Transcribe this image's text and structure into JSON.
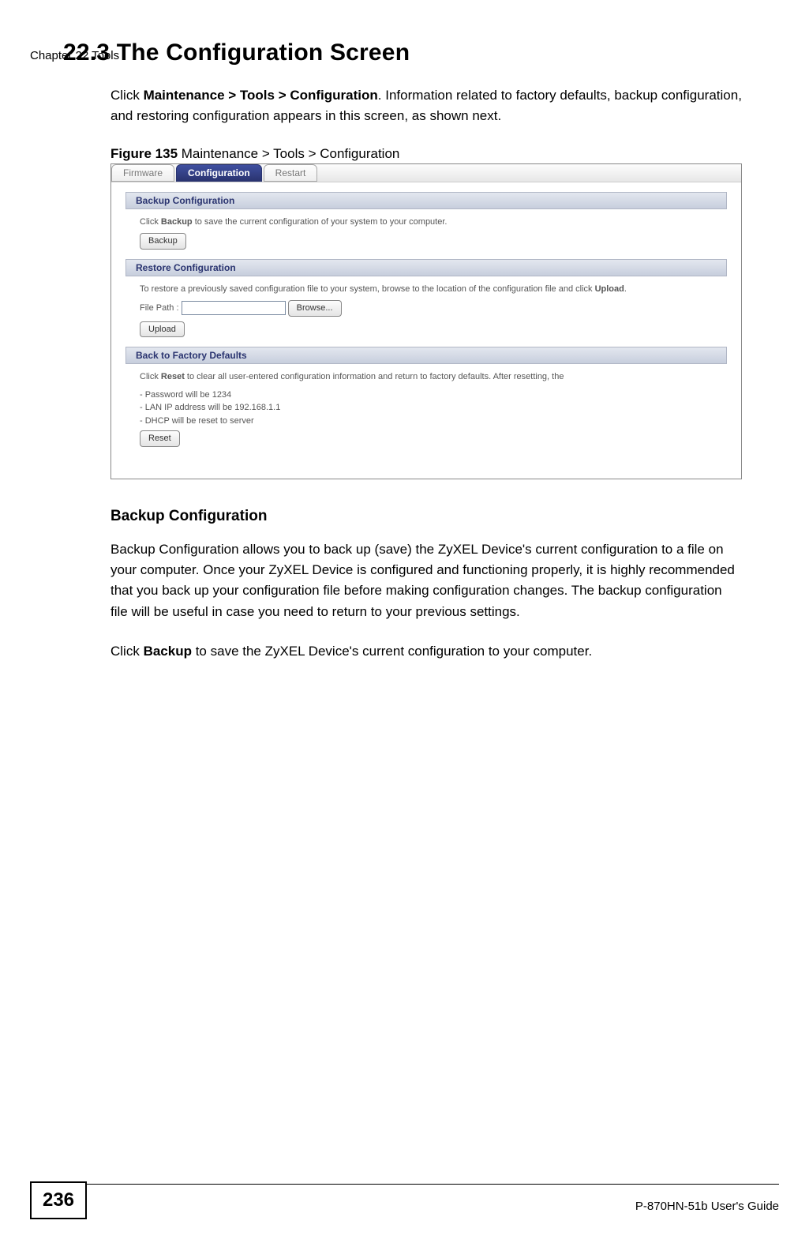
{
  "header": {
    "chapter": "Chapter 22 Tools"
  },
  "section": {
    "number_title": "22.3  The Configuration Screen",
    "intro_part1": "Click ",
    "intro_bold": "Maintenance > Tools > Configuration",
    "intro_part2": ". Information related to factory defaults, backup configuration, and restoring configuration appears in this screen, as shown next."
  },
  "figure": {
    "label": "Figure 135",
    "caption_rest": "   Maintenance > Tools > Configuration"
  },
  "screenshot": {
    "tabs": {
      "firmware": "Firmware",
      "configuration": "Configuration",
      "restart": "Restart"
    },
    "backup": {
      "header": "Backup Configuration",
      "text_pre": "Click ",
      "text_bold": "Backup",
      "text_post": " to save the current configuration of your system to your computer.",
      "button": "Backup"
    },
    "restore": {
      "header": "Restore Configuration",
      "text_pre": "To restore a previously saved configuration file to your system, browse to the location of the configuration file and click ",
      "text_bold": "Upload",
      "text_post": ".",
      "file_path_label": "File Path :",
      "browse_button": "Browse...",
      "upload_button": "Upload"
    },
    "factory": {
      "header": "Back to Factory Defaults",
      "text_pre": "Click ",
      "text_bold": "Reset",
      "text_post": " to clear all user-entered configuration information and return to factory defaults. After resetting, the",
      "bullet1": "- Password will be 1234",
      "bullet2": "- LAN IP address will be 192.168.1.1",
      "bullet3": "- DHCP will be reset to server",
      "reset_button": "Reset"
    }
  },
  "subsection": {
    "heading": "Backup Configuration",
    "para1": "Backup Configuration allows you to back up (save) the ZyXEL Device's current configuration to a file on your computer. Once your ZyXEL Device is configured and functioning properly, it is highly recommended that you back up your configuration file before making configuration changes. The backup configuration file will be useful in case you need to return to your previous settings.",
    "para2_pre": "Click ",
    "para2_bold": "Backup",
    "para2_post": " to save the ZyXEL Device's current configuration to your computer."
  },
  "footer": {
    "page": "236",
    "guide": "P-870HN-51b User's Guide"
  }
}
